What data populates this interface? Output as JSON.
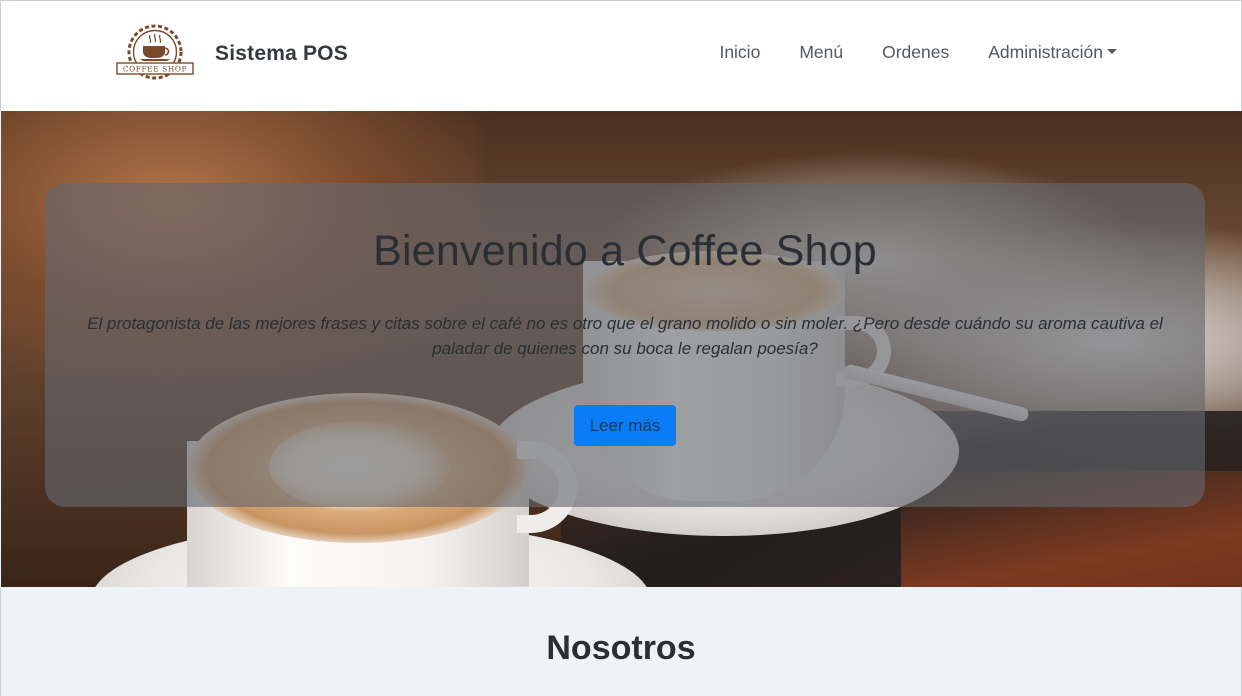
{
  "navbar": {
    "brand": "Sistema POS",
    "logo_text": "COFFEE SHOP",
    "links": [
      {
        "label": "Inicio"
      },
      {
        "label": "Menú"
      },
      {
        "label": "Ordenes"
      },
      {
        "label": "Administración",
        "dropdown": true
      }
    ]
  },
  "hero": {
    "title": "Bienvenido a Coffee Shop",
    "text": "El protagonista de las mejores frases y citas sobre el café no es otro que el grano molido o sin moler. ¿Pero desde cuándo su aroma cautiva el paladar de quienes con su boca le regalan poesía?",
    "button_label": "Leer más"
  },
  "about": {
    "title": "Nosotros"
  },
  "colors": {
    "primary_button": "#0a7cf5",
    "navbar_bg": "#ffffff",
    "section_bg": "#eef3f8",
    "logo_brown": "#7a4a2a"
  },
  "icons": {
    "logo": "coffee-cup-gear-logo",
    "dropdown": "caret-down-icon"
  }
}
